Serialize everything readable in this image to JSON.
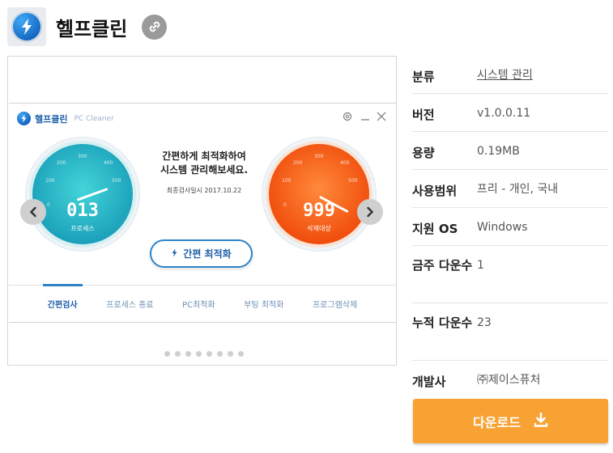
{
  "header": {
    "app_name": "헬프클린",
    "icon": "lightning-bolt-icon",
    "link_icon": "link-icon"
  },
  "screenshot": {
    "window_title": "헬프클린",
    "window_subtitle": "PC Cleaner",
    "controls": [
      "gear-icon",
      "minimize-icon",
      "close-icon"
    ],
    "gauge_left": {
      "value": "013",
      "label": "프로세스",
      "ticks": [
        "0",
        "100",
        "200",
        "300",
        "400",
        "500"
      ]
    },
    "gauge_right": {
      "value": "999",
      "label": "삭제대상",
      "ticks": [
        "0",
        "100",
        "200",
        "300",
        "400",
        "500"
      ]
    },
    "headline_line1": "간편하게 최적화하여",
    "headline_line2": "시스템 관리해보세요.",
    "last_scan": "최종검사일시 2017.10.22",
    "optimize_button": "간편 최적화",
    "tabs": [
      {
        "label": "간편검사",
        "active": true
      },
      {
        "label": "프로세스 종료",
        "active": false
      },
      {
        "label": "PC최적화",
        "active": false
      },
      {
        "label": "부팅 최적화",
        "active": false
      },
      {
        "label": "프로그램삭제",
        "active": false
      }
    ]
  },
  "gallery": {
    "dot_count": 8,
    "prev_icon": "chevron-left-icon",
    "next_icon": "chevron-right-icon"
  },
  "info": {
    "category_label": "분류",
    "category_value": "시스템 관리",
    "version_label": "버전",
    "version_value": "v1.0.0.11",
    "size_label": "용량",
    "size_value": "0.19MB",
    "license_label": "사용범위",
    "license_value": "프리 - 개인, 국내",
    "os_label": "지원 OS",
    "os_value": "Windows",
    "weekly_label": "금주 다운수",
    "weekly_value": "1",
    "total_label": "누적 다운수",
    "total_value": "23",
    "developer_label": "개발사",
    "developer_value": "㈜제이스퓨처"
  },
  "download": {
    "label": "다운로드",
    "icon": "download-icon"
  },
  "colors": {
    "download_bg": "#f9a234",
    "accent_blue": "#1f5fa8",
    "gauge_blue": "#1a9fb9",
    "gauge_orange": "#f04b0b"
  }
}
